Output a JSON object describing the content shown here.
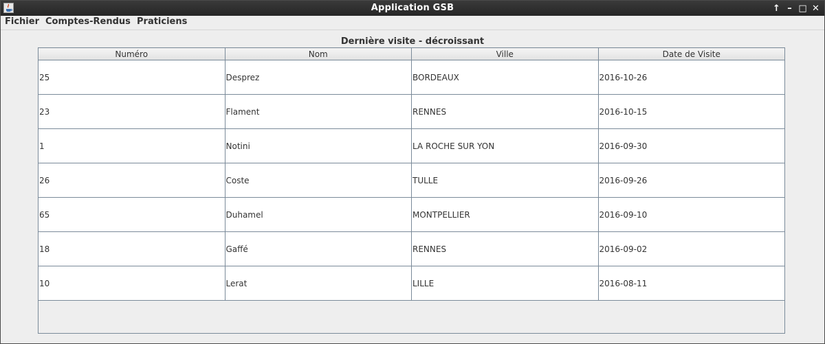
{
  "window": {
    "title": "Application GSB",
    "controls": [
      "↑",
      "–",
      "□",
      "✕"
    ]
  },
  "menu": {
    "items": [
      "Fichier",
      "Comptes-Rendus",
      "Praticiens"
    ]
  },
  "table": {
    "title": "Dernière visite - décroissant",
    "columns": [
      "Numéro",
      "Nom",
      "Ville",
      "Date de Visite"
    ],
    "rows": [
      [
        "25",
        "Desprez",
        "BORDEAUX",
        "2016-10-26"
      ],
      [
        "23",
        "Flament",
        "RENNES",
        "2016-10-15"
      ],
      [
        "1",
        "Notini",
        "LA ROCHE SUR YON",
        "2016-09-30"
      ],
      [
        "26",
        "Coste",
        "TULLE",
        "2016-09-26"
      ],
      [
        "65",
        "Duhamel",
        "MONTPELLIER",
        "2016-09-10"
      ],
      [
        "18",
        "Gaffé",
        "RENNES",
        "2016-09-02"
      ],
      [
        "10",
        "Lerat",
        "LILLE",
        "2016-08-11"
      ]
    ]
  },
  "colors": {
    "titlebar": "#2f2f2f",
    "background": "#eeeeee",
    "grid": "#7a8a99"
  }
}
